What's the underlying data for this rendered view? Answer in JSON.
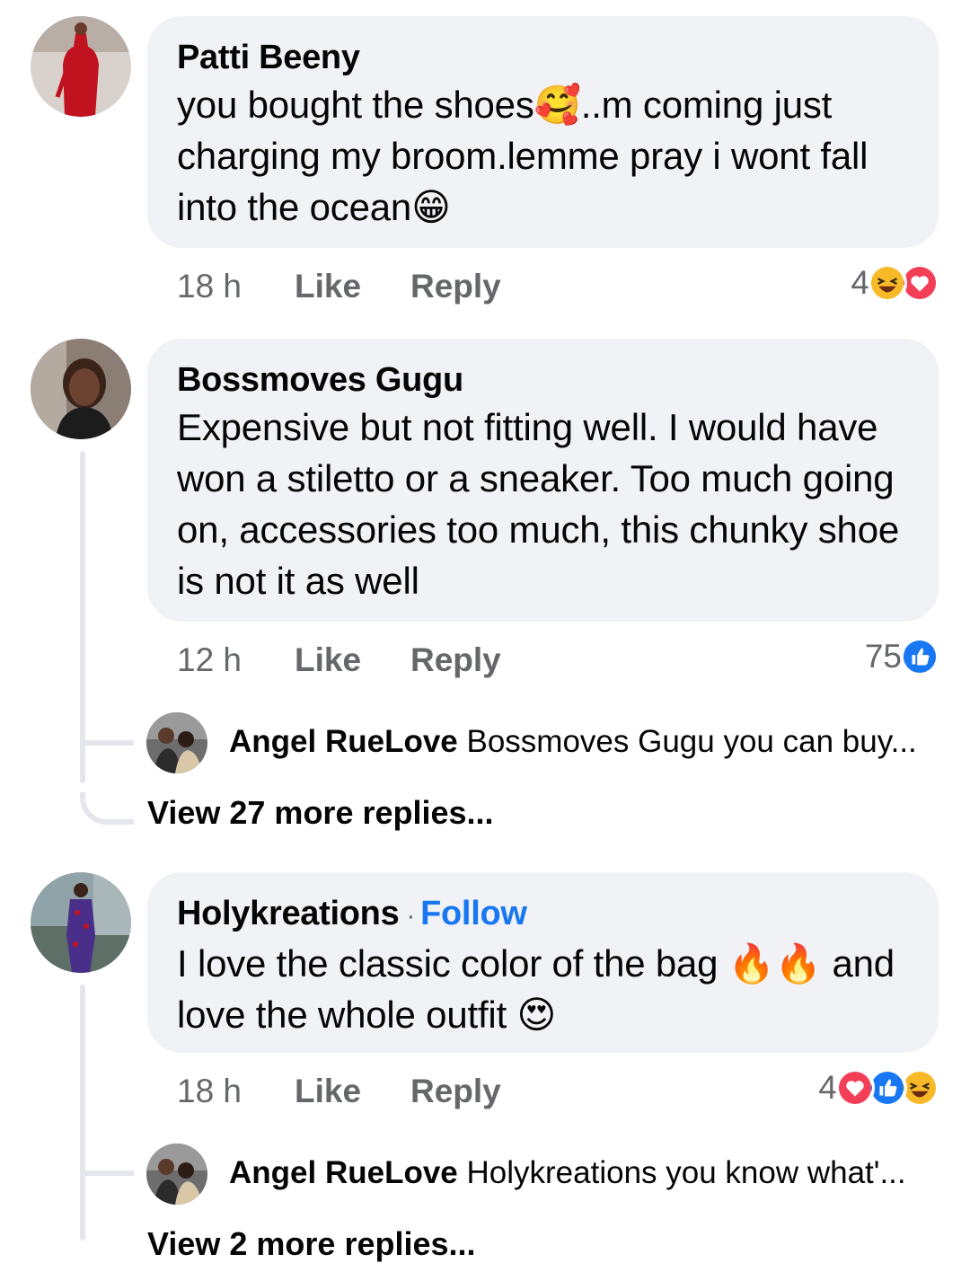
{
  "comments": [
    {
      "author": "Patti Beeny",
      "text": "you bought the shoes🥰..m coming just charging my broom.lemme pray i wont fall into the ocean😁",
      "time": "18 h",
      "like_label": "Like",
      "reply_label": "Reply",
      "reaction_count": "4",
      "reactions": [
        "haha-icon",
        "love-icon"
      ]
    },
    {
      "author": "Bossmoves Gugu",
      "text": "Expensive but not fitting well. I would have won a stiletto or a sneaker. Too much going on, accessories too much, this chunky shoe is not it as well",
      "time": "12 h",
      "like_label": "Like",
      "reply_label": "Reply",
      "reaction_count": "75",
      "reactions": [
        "like-icon"
      ],
      "reply_preview": {
        "author": "Angel RueLove",
        "text": "Bossmoves Gugu you can buy..."
      },
      "view_more": "View 27 more replies..."
    },
    {
      "author": "Holykreations",
      "follow_sep": "·",
      "follow_label": "Follow",
      "text": "I love the classic color of the bag 🔥🔥 and love the whole outfit 😍",
      "time": "18 h",
      "like_label": "Like",
      "reply_label": "Reply",
      "reaction_count": "4",
      "reactions": [
        "love-icon",
        "like-icon",
        "haha-icon"
      ],
      "reply_preview": {
        "author": "Angel RueLove",
        "text": "Holykreations you know what'..."
      },
      "view_more": "View 2 more replies..."
    }
  ],
  "colors": {
    "bubble_bg": "#f0f2f5",
    "meta_text": "#65676b",
    "link_blue": "#1877f2",
    "love_red": "#f33e58",
    "haha_yellow": "#f7b928"
  }
}
